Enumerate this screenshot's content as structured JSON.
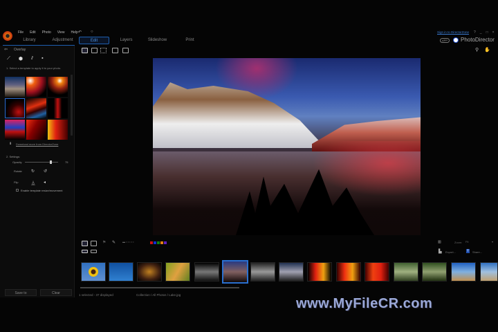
{
  "menu": {
    "items": [
      "File",
      "Edit",
      "Photo",
      "View",
      "Help"
    ]
  },
  "header": {
    "signin": "Sign in to DirectorZone",
    "help": "?",
    "minimize": "_",
    "restore": "□",
    "close": "×",
    "app_badge": "APP",
    "app_name": "PhotoDirector"
  },
  "tabs": [
    "Library",
    "Adjustment",
    "Edit",
    "Layers",
    "Slideshow",
    "Print"
  ],
  "active_tab": "Edit",
  "left_panel": {
    "back_label": "Overlay",
    "step1": "1. Select a template to apply it to your photo.",
    "download_link": "Download more from DirectorZone",
    "step2": "2. Settings:",
    "opacity_label": "Opacity",
    "opacity_value": "75",
    "opacity_fraction": 0.75,
    "rotate_label": "Rotate",
    "flip_label": "Flip",
    "checkbox_label": "Enable template resize/movement",
    "save_to": "Save to",
    "clear": "Clear"
  },
  "bottom_toolbar": {
    "zoom_label": "Zoom:",
    "zoom_value": "Fit",
    "export": "Export...",
    "share": "Share...",
    "color_labels": [
      "#d01010",
      "#1030d0",
      "#108010",
      "#e08010",
      "#6020c0"
    ]
  },
  "status": {
    "selection": "1 selected - 37 displayed",
    "path": "Collection / All Photos / Lake.jpg"
  },
  "watermark": "www.MyFileCR.com"
}
